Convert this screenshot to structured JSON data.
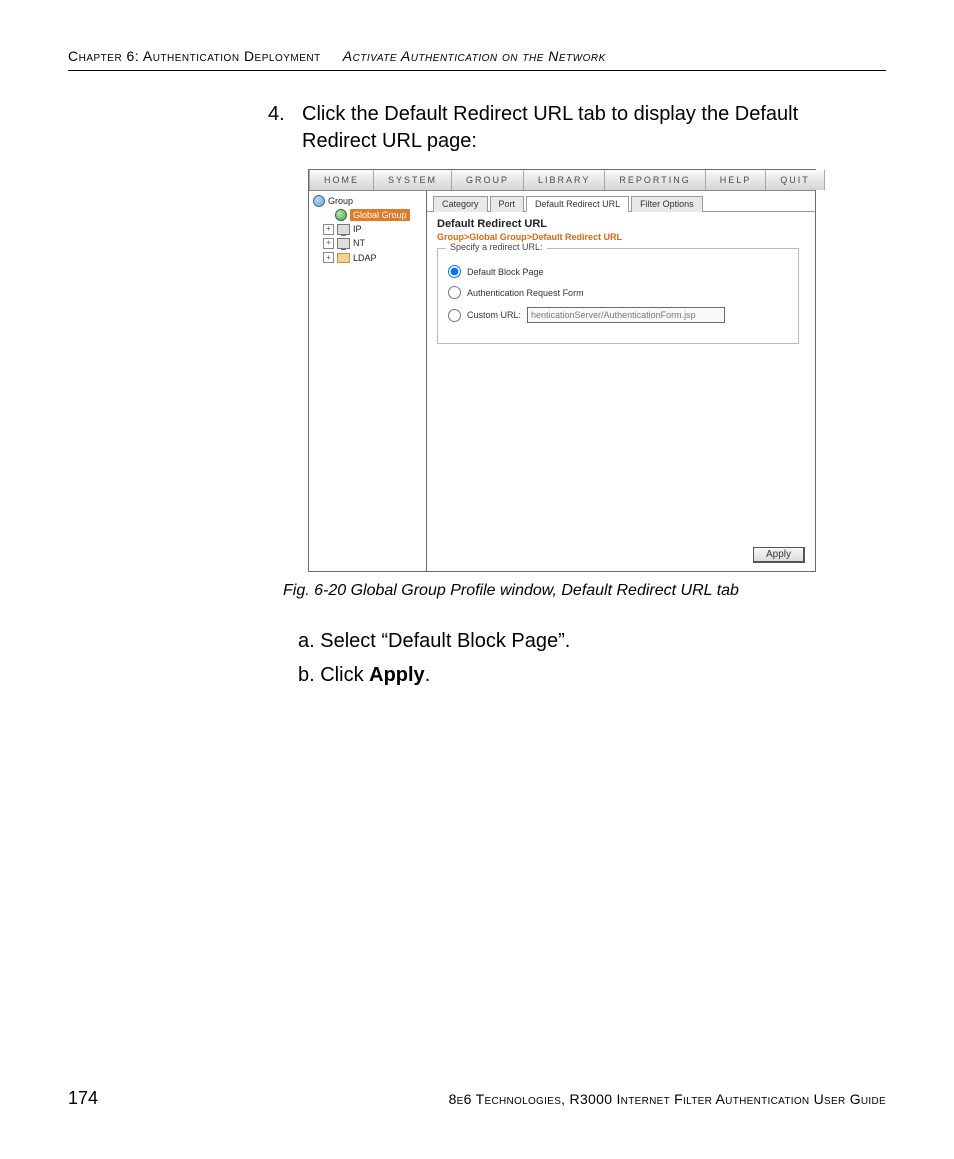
{
  "header": {
    "chapter_left": "Chapter 6: Authentication Deployment",
    "chapter_right": "Activate Authentication on the Network"
  },
  "step": {
    "number": "4.",
    "text": "Click the Default Redirect URL tab to display the Default Redirect URL page:"
  },
  "app": {
    "menus": [
      "HOME",
      "SYSTEM",
      "GROUP",
      "LIBRARY",
      "REPORTING",
      "HELP",
      "QUIT"
    ],
    "tree": {
      "root": "Group",
      "items": [
        {
          "label": "Global Group",
          "selected": true
        },
        {
          "label": "IP"
        },
        {
          "label": "NT"
        },
        {
          "label": "LDAP"
        }
      ]
    },
    "tabs": [
      "Category",
      "Port",
      "Default Redirect URL",
      "Filter Options"
    ],
    "active_tab": 2,
    "title": "Default Redirect URL",
    "breadcrumb": "Group>Global Group>Default Redirect URL",
    "fieldset_legend": "Specify a redirect URL:",
    "options": {
      "default_block": "Default Block Page",
      "auth_request": "Authentication Request Form",
      "custom_label": "Custom URL:",
      "custom_value": "henticationServer/AuthenticationForm.jsp"
    },
    "apply": "Apply"
  },
  "caption": "Fig. 6-20  Global Group Profile window, Default Redirect URL tab",
  "substeps": {
    "a": "a. Select “Default Block Page”.",
    "b_pre": "b. Click ",
    "b_bold": "Apply",
    "b_post": "."
  },
  "footer": {
    "page": "174",
    "text": "8e6 Technologies, R3000 Internet Filter Authentication User Guide"
  }
}
